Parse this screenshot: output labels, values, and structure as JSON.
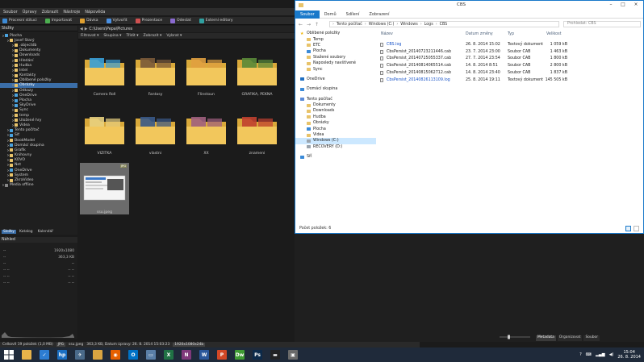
{
  "viewer": {
    "menu": [
      "Soubor",
      "Úpravy",
      "Zobrazit",
      "Nástroje",
      "Nápověda"
    ],
    "toolbar": [
      "Procesní stituci",
      "Importovat",
      "Dávka",
      "Vytvořit",
      "Prezentace",
      "Odeslat",
      "Externí editory"
    ],
    "folders_header": "Složky",
    "tree": [
      {
        "label": "Plocha",
        "indent": 0,
        "color": "#4aa3df"
      },
      {
        "label": "Josef Starý",
        "indent": 1,
        "color": "#e8c36a"
      },
      {
        "label": ".objectdb",
        "indent": 2,
        "color": "#e8c36a"
      },
      {
        "label": "Dokumenty",
        "indent": 2,
        "color": "#e8c36a"
      },
      {
        "label": "Downloads",
        "indent": 2,
        "color": "#e8c36a"
      },
      {
        "label": "Hledání",
        "indent": 2,
        "color": "#e8c36a"
      },
      {
        "label": "Hudba",
        "indent": 2,
        "color": "#e8c36a"
      },
      {
        "label": "Intel",
        "indent": 2,
        "color": "#e8c36a"
      },
      {
        "label": "Kontakty",
        "indent": 2,
        "color": "#e8c36a"
      },
      {
        "label": "Oblíbené položky",
        "indent": 2,
        "color": "#e8c36a"
      },
      {
        "label": "Obrázky",
        "indent": 2,
        "color": "#e8c36a",
        "selected": true
      },
      {
        "label": "Odkazy",
        "indent": 2,
        "color": "#e8c36a"
      },
      {
        "label": "OneDrive",
        "indent": 2,
        "color": "#4aa3df"
      },
      {
        "label": "Plocha",
        "indent": 2,
        "color": "#4aa3df"
      },
      {
        "label": "SkyDrive",
        "indent": 2,
        "color": "#4aa3df"
      },
      {
        "label": "Sync",
        "indent": 2,
        "color": "#e8c36a"
      },
      {
        "label": "temp",
        "indent": 2,
        "color": "#e8c36a"
      },
      {
        "label": "Uložené hry",
        "indent": 2,
        "color": "#e8c36a"
      },
      {
        "label": "Videa",
        "indent": 2,
        "color": "#e8c36a"
      },
      {
        "label": "Tento počítač",
        "indent": 1,
        "color": "#4aa3df"
      },
      {
        "label": "Síť",
        "indent": 1,
        "color": "#4aa3df"
      },
      {
        "label": "BookModel",
        "indent": 1,
        "color": "#e8c36a"
      },
      {
        "label": "Domácí skupina",
        "indent": 1,
        "color": "#4aa3df"
      },
      {
        "label": "Grafik",
        "indent": 1,
        "color": "#e8c36a"
      },
      {
        "label": "Knihovny",
        "indent": 1,
        "color": "#e8c36a"
      },
      {
        "label": "KOVO",
        "indent": 1,
        "color": "#e8c36a"
      },
      {
        "label": "Net",
        "indent": 1,
        "color": "#e8c36a"
      },
      {
        "label": "OneDrive",
        "indent": 1,
        "color": "#4aa3df"
      },
      {
        "label": "System",
        "indent": 1,
        "color": "#e8c36a"
      },
      {
        "label": "ZkraVideo",
        "indent": 1,
        "color": "#e8c36a"
      },
      {
        "label": "Media offline",
        "indent": 0,
        "color": "#888888"
      }
    ],
    "pane_tabs": [
      "Složky",
      "Katalog",
      "Kalendář"
    ],
    "preview_header": "Náhled",
    "props": [
      {
        "k": "--",
        "v": "1920x1080"
      },
      {
        "k": "--",
        "v": "363,3 KB"
      },
      {
        "k": "--",
        "v": "--"
      },
      {
        "k": "--      --",
        "v": "--      --"
      },
      {
        "k": "--      --",
        "v": "--      --"
      },
      {
        "k": "--      --",
        "v": "--      --"
      }
    ],
    "address": "C:\\Users\\Pepa\\Pictures",
    "filters": [
      "Filtrovat",
      "Skupina",
      "Třídit",
      "Zobrazit",
      "Vybrat"
    ],
    "thumbs": [
      {
        "label": "Camera Roll",
        "tint": "#3aa0d8"
      },
      {
        "label": "Fantasy",
        "tint": "#7a5a3a"
      },
      {
        "label": "Flinstoun",
        "tint": "#e0a040"
      },
      {
        "label": "GRAFIKA, PEKNA",
        "tint": "#5a8a3a"
      },
      {
        "label": "VIZITKA",
        "tint": "#e8d080"
      },
      {
        "label": "vlastni",
        "tint": "#3a5a8a"
      },
      {
        "label": "XX",
        "tint": "#a06080"
      },
      {
        "label": "znameni",
        "tint": "#c04030"
      },
      {
        "label": "ssu.jpeg",
        "tint": "#ffffff",
        "badge": "JPG"
      }
    ],
    "status": {
      "summary": "Celkově 19 položek (1,0 MB)",
      "badge": "JPG",
      "file": "ssu.jpeg",
      "meta": "363,3 KB, Datum úpravy: 26. 8. 2014 15:03:23",
      "dims": "1920x1080x24b"
    },
    "bottom_tabs": [
      "Metadata",
      "Organizovat",
      "Soubor"
    ]
  },
  "explorer": {
    "title": "CBS",
    "ribbon": [
      "Soubor",
      "Domů",
      "Sdílení",
      "Zobrazení"
    ],
    "path": [
      "Tento počítač",
      "Windows (C:)",
      "Windows",
      "Logs",
      "CBS"
    ],
    "search_placeholder": "Prohledat: CBS",
    "nav": [
      {
        "label": "Oblíbené položky",
        "type": "star",
        "indent": 0
      },
      {
        "label": "Temp",
        "type": "folder",
        "indent": 1
      },
      {
        "label": "ETC",
        "type": "folder",
        "indent": 1
      },
      {
        "label": "Plocha",
        "type": "blue",
        "indent": 1
      },
      {
        "label": "Stažené soubory",
        "type": "folder",
        "indent": 1
      },
      {
        "label": "Naposledy navštívené",
        "type": "folder",
        "indent": 1
      },
      {
        "label": "Sync",
        "type": "folder",
        "indent": 1
      },
      {
        "label": "",
        "type": "gap",
        "indent": 0
      },
      {
        "label": "OneDrive",
        "type": "cloud",
        "indent": 0
      },
      {
        "label": "",
        "type": "gap",
        "indent": 0
      },
      {
        "label": "Domácí skupina",
        "type": "blue",
        "indent": 0
      },
      {
        "label": "",
        "type": "gap",
        "indent": 0
      },
      {
        "label": "Tento počítač",
        "type": "pc",
        "indent": 0
      },
      {
        "label": "Dokumenty",
        "type": "folder",
        "indent": 1
      },
      {
        "label": "Downloads",
        "type": "folder",
        "indent": 1
      },
      {
        "label": "Hudba",
        "type": "folder",
        "indent": 1
      },
      {
        "label": "Obrázky",
        "type": "folder",
        "indent": 1
      },
      {
        "label": "Plocha",
        "type": "blue",
        "indent": 1
      },
      {
        "label": "Videa",
        "type": "folder",
        "indent": 1
      },
      {
        "label": "Windows (C:)",
        "type": "drive",
        "indent": 1,
        "selected": true
      },
      {
        "label": "RECOVERY (D:)",
        "type": "drive",
        "indent": 1
      },
      {
        "label": "",
        "type": "gap",
        "indent": 0
      },
      {
        "label": "Síť",
        "type": "net",
        "indent": 0
      }
    ],
    "columns": {
      "name": "Název",
      "date": "Datum změny",
      "type": "Typ",
      "size": "Velikost"
    },
    "files": [
      {
        "name": "CBS.log",
        "date": "26. 8. 2014 15:02",
        "type": "Textový dokument",
        "size": "1 059 kB",
        "blue": true
      },
      {
        "name": "CbsPersist_20140723211446.cab",
        "date": "23. 7. 2014 23:00",
        "type": "Soubor CAB",
        "size": "1 463 kB",
        "blue": false
      },
      {
        "name": "CbsPersist_20140725055337.cab",
        "date": "27. 7. 2014 23:54",
        "type": "Soubor CAB",
        "size": "1 800 kB",
        "blue": false
      },
      {
        "name": "CbsPersist_20140814065514.cab",
        "date": "14. 8. 2014 8:51",
        "type": "Soubor CAB",
        "size": "2 800 kB",
        "blue": false
      },
      {
        "name": "CbsPersist_20140815062712.cab",
        "date": "14. 8. 2014 23:40",
        "type": "Soubor CAB",
        "size": "1 837 kB",
        "blue": false
      },
      {
        "name": "CbsPersist_20140826113109.log",
        "date": "25. 8. 2014 19:11",
        "type": "Textový dokument",
        "size": "145 505 kB",
        "blue": true
      }
    ],
    "status": "Počet položek: 6"
  },
  "taskbar": {
    "apps": [
      {
        "name": "file-explorer",
        "color": "#e8b34a",
        "glyph": ""
      },
      {
        "name": "checkmark-app",
        "color": "#2d7dd2",
        "glyph": "✓"
      },
      {
        "name": "hp-app",
        "color": "#1b6fc2",
        "glyph": "hp"
      },
      {
        "name": "airplane-app",
        "color": "#4a6a8a",
        "glyph": "✈"
      },
      {
        "name": "folder-app",
        "color": "#d9a441",
        "glyph": ""
      },
      {
        "name": "firefox-app",
        "color": "#e66000",
        "glyph": "◉"
      },
      {
        "name": "outlook-app",
        "color": "#0072c6",
        "glyph": "O"
      },
      {
        "name": "remote-app",
        "color": "#5a7fa8",
        "glyph": "▭"
      },
      {
        "name": "excel-app",
        "color": "#207245",
        "glyph": "X"
      },
      {
        "name": "onenote-app",
        "color": "#80397b",
        "glyph": "N"
      },
      {
        "name": "word-app",
        "color": "#2b579a",
        "glyph": "W"
      },
      {
        "name": "powerpoint-app",
        "color": "#d24726",
        "glyph": "P"
      },
      {
        "name": "dreamweaver-app",
        "color": "#3f9b33",
        "glyph": "Dw"
      },
      {
        "name": "photoshop-app",
        "color": "#0c2a4a",
        "glyph": "Ps"
      },
      {
        "name": "cmd-app",
        "color": "#222222",
        "glyph": "▬"
      },
      {
        "name": "viewer-app",
        "color": "#6a6a6a",
        "glyph": "▣"
      }
    ],
    "time": "15:04",
    "date": "26. 8. 2014"
  }
}
